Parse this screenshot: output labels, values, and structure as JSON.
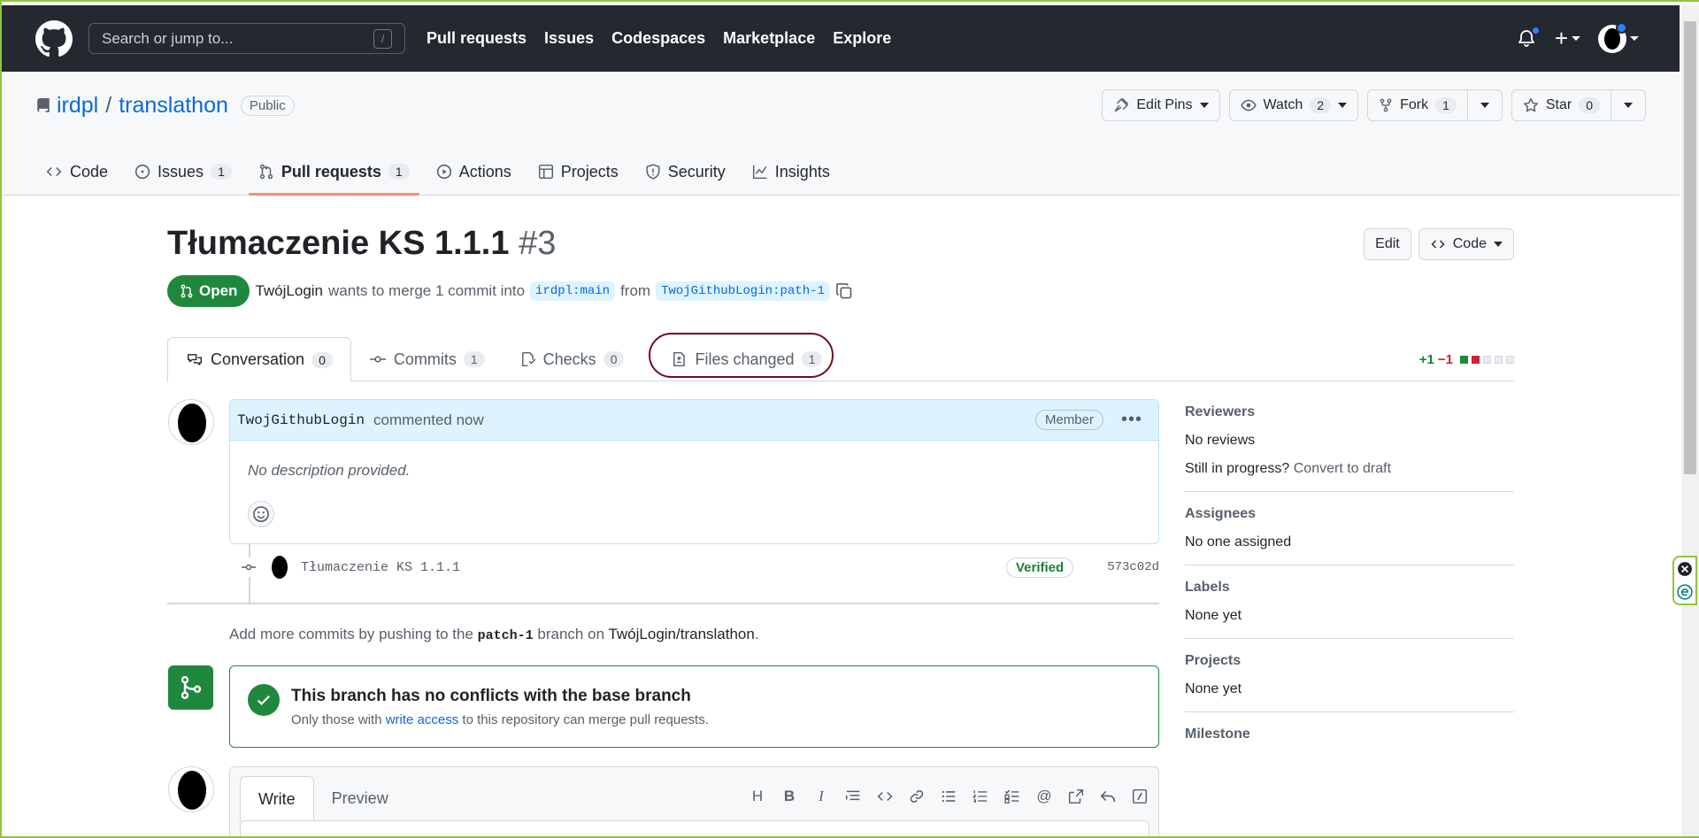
{
  "header": {
    "search_placeholder": "Search or jump to...",
    "search_key": "/",
    "nav": [
      "Pull requests",
      "Issues",
      "Codespaces",
      "Marketplace",
      "Explore"
    ],
    "plus": "+"
  },
  "repo": {
    "owner": "irdpl",
    "separator": "/",
    "name": "translathon",
    "visibility": "Public",
    "actions": {
      "edit_pins": "Edit Pins",
      "watch": "Watch",
      "watch_count": "2",
      "fork": "Fork",
      "fork_count": "1",
      "star": "Star",
      "star_count": "0"
    },
    "tabs": [
      {
        "label": "Code",
        "count": ""
      },
      {
        "label": "Issues",
        "count": "1"
      },
      {
        "label": "Pull requests",
        "count": "1"
      },
      {
        "label": "Actions",
        "count": ""
      },
      {
        "label": "Projects",
        "count": ""
      },
      {
        "label": "Security",
        "count": ""
      },
      {
        "label": "Insights",
        "count": ""
      }
    ]
  },
  "pr": {
    "title": "Tłumaczenie KS 1.1.1",
    "number": "#3",
    "edit": "Edit",
    "code": "Code",
    "state": "Open",
    "author": "TwójLogin",
    "meta_text": "wants to merge 1 commit into",
    "base_branch": "irdpl:main",
    "from": "from",
    "head_branch": "TwojGithubLogin:path-1",
    "tabs": [
      {
        "label": "Conversation",
        "count": "0"
      },
      {
        "label": "Commits",
        "count": "1"
      },
      {
        "label": "Checks",
        "count": "0"
      },
      {
        "label": "Files changed",
        "count": "1"
      }
    ],
    "diffstat": {
      "added": "+1",
      "removed": "−1"
    }
  },
  "comment": {
    "login": "TwojGithubLogin",
    "timestamp": "commented now",
    "role": "Member",
    "body": "No description provided."
  },
  "commit": {
    "message": "Tłumaczenie KS 1.1.1",
    "verified": "Verified",
    "sha": "573c02d"
  },
  "push_hint": {
    "prefix": "Add more commits by pushing to the",
    "branch": "patch-1",
    "middle": "branch on",
    "repo": "TwójLogin/translathon",
    "suffix": "."
  },
  "merge": {
    "title": "This branch has no conflicts with the base branch",
    "sub_prefix": "Only those with",
    "sub_link": "write access",
    "sub_suffix": "to this repository can merge pull requests."
  },
  "composer": {
    "write": "Write",
    "preview": "Preview",
    "toolbar_icons": [
      "heading-icon",
      "bold-icon",
      "italic-icon",
      "quote-icon",
      "code-icon",
      "link-icon",
      "bullet-list-icon",
      "numbered-list-icon",
      "task-list-icon",
      "mention-icon",
      "cross-reference-icon",
      "saved-reply-icon",
      "slash-command-icon"
    ]
  },
  "sidebar": {
    "reviewers": {
      "heading": "Reviewers",
      "value": "No reviews",
      "progress_prefix": "Still in progress?",
      "progress_link": "Convert to draft"
    },
    "assignees": {
      "heading": "Assignees",
      "value": "No one assigned"
    },
    "labels": {
      "heading": "Labels",
      "value": "None yet"
    },
    "projects": {
      "heading": "Projects",
      "value": "None yet"
    },
    "milestone": {
      "heading": "Milestone"
    }
  },
  "colors": {
    "header_bg": "#24292f",
    "open_green": "#1f883d",
    "link_blue": "#0969da",
    "highlight_ring": "#6e0d1d"
  }
}
